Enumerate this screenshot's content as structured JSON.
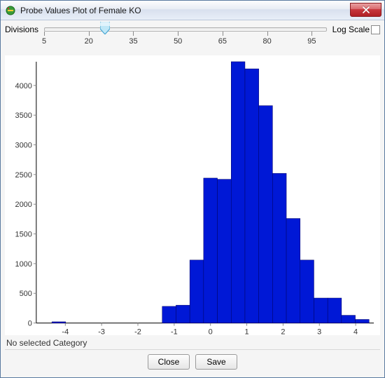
{
  "window": {
    "title": "Probe Values Plot of Female KO"
  },
  "controls": {
    "divisions_label": "Divisions",
    "slider": {
      "min": 5,
      "max": 100,
      "value": 25,
      "tick_labels": [
        5,
        20,
        35,
        50,
        65,
        80,
        95
      ]
    },
    "log_scale_label": "Log Scale",
    "log_scale_checked": false
  },
  "chart_data": {
    "type": "bar",
    "title": "",
    "xlabel": "",
    "ylabel": "",
    "xlim": [
      -4.8,
      4.5
    ],
    "ylim": [
      0,
      4400
    ],
    "x_ticks": [
      -4,
      -3,
      -2,
      -1,
      0,
      1,
      2,
      3,
      4
    ],
    "y_ticks": [
      0,
      500,
      1000,
      1500,
      2000,
      2500,
      3000,
      3500,
      4000
    ],
    "bin_width": 0.38,
    "bars": [
      {
        "x_left": -4.37,
        "count": 20
      },
      {
        "x_left": -1.33,
        "count": 280
      },
      {
        "x_left": -0.95,
        "count": 300
      },
      {
        "x_left": -0.57,
        "count": 1060
      },
      {
        "x_left": -0.19,
        "count": 2440
      },
      {
        "x_left": 0.19,
        "count": 2420
      },
      {
        "x_left": 0.57,
        "count": 4400
      },
      {
        "x_left": 0.95,
        "count": 4280
      },
      {
        "x_left": 1.33,
        "count": 3660
      },
      {
        "x_left": 1.71,
        "count": 2520
      },
      {
        "x_left": 2.09,
        "count": 1760
      },
      {
        "x_left": 2.47,
        "count": 1060
      },
      {
        "x_left": 2.85,
        "count": 420
      },
      {
        "x_left": 3.23,
        "count": 420
      },
      {
        "x_left": 3.61,
        "count": 130
      },
      {
        "x_left": 3.99,
        "count": 60
      }
    ]
  },
  "status": {
    "text": "No selected Category"
  },
  "buttons": {
    "close": "Close",
    "save": "Save"
  },
  "colors": {
    "bar_fill": "#0018d6",
    "bar_stroke": "#000060"
  }
}
